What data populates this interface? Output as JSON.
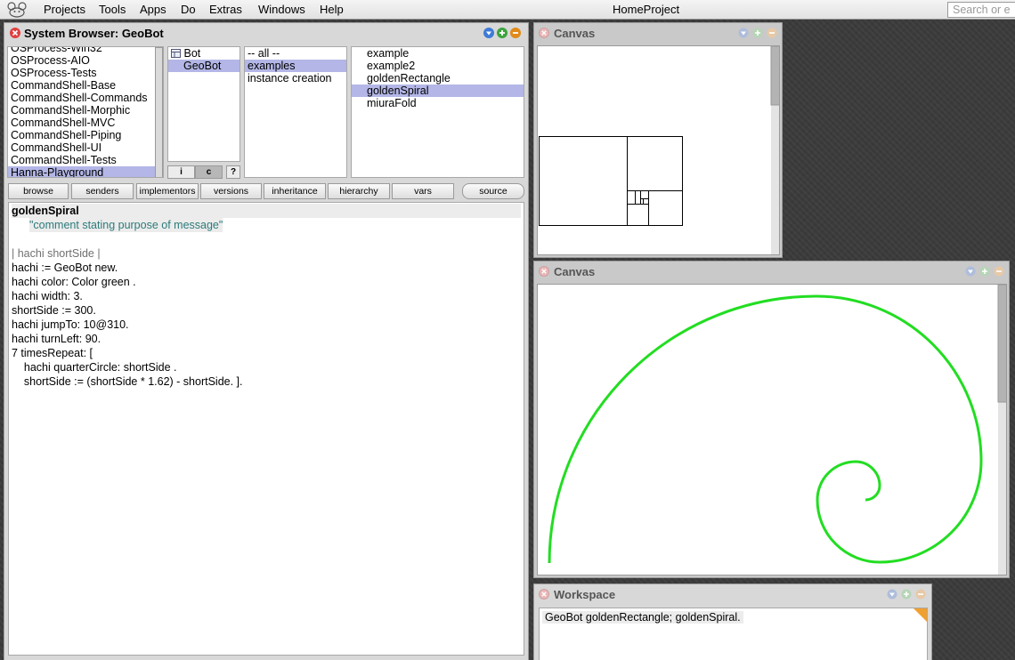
{
  "menubar": {
    "items": [
      "Projects",
      "Tools",
      "Apps",
      "Do",
      "Extras",
      "Windows",
      "Help"
    ],
    "project_title": "HomeProject",
    "search_placeholder": "Search or e"
  },
  "browser": {
    "title": "System Browser: GeoBot",
    "packages": [
      "OSProcess-Win32",
      "OSProcess-AIO",
      "OSProcess-Tests",
      "CommandShell-Base",
      "CommandShell-Commands",
      "CommandShell-Morphic",
      "CommandShell-MVC",
      "CommandShell-Piping",
      "CommandShell-UI",
      "CommandShell-Tests",
      "Hanna-Playground"
    ],
    "selected_package": "Hanna-Playground",
    "classes": [
      "Bot",
      "GeoBot"
    ],
    "selected_class": "GeoBot",
    "class_toggles": [
      "i",
      "c",
      "?"
    ],
    "categories": [
      "-- all --",
      "examples",
      "instance creation"
    ],
    "selected_category": "examples",
    "methods": [
      "example",
      "example2",
      "goldenRectangle",
      "goldenSpiral",
      "miuraFold"
    ],
    "selected_method": "goldenSpiral",
    "buttons": [
      "browse",
      "senders",
      "implementors",
      "versions",
      "inheritance",
      "hierarchy",
      "vars",
      "source"
    ],
    "code": {
      "header": "goldenSpiral",
      "comment": "\"comment stating purpose of message\"",
      "lines": [
        "| hachi shortSide |",
        "hachi := GeoBot new.",
        "hachi color: Color green .",
        "hachi width: 3.",
        "shortSide := 300.",
        "hachi jumpTo: 10@310.",
        "hachi turnLeft: 90.",
        "7 timesRepeat: [",
        "    hachi quarterCircle: shortSide .",
        "    shortSide := (shortSide * 1.62) - shortSide. ]."
      ]
    }
  },
  "canvas1": {
    "title": "Canvas"
  },
  "canvas2": {
    "title": "Canvas",
    "spiral_color": "#22dd22"
  },
  "workspace": {
    "title": "Workspace",
    "text": "GeoBot goldenRectangle; goldenSpiral."
  },
  "colors": {
    "selection": "#b3b6e6",
    "close": "#e04040",
    "menu": "#3e7bd6",
    "expand": "#3ea33e",
    "collapse": "#e08a1a"
  }
}
